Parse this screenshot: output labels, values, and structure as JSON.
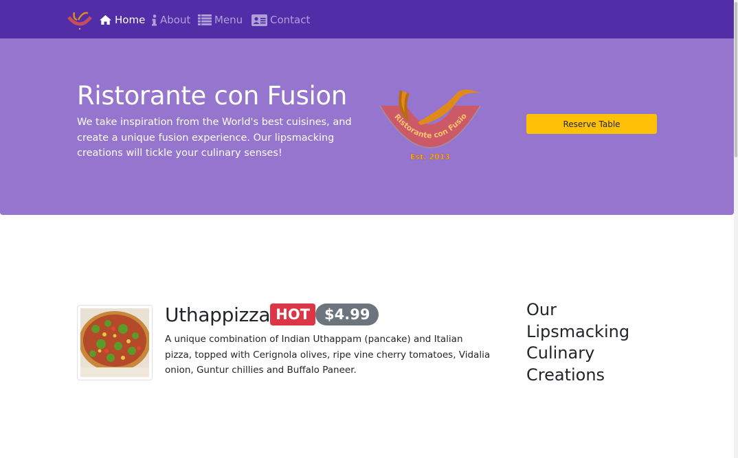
{
  "navbar": {
    "brand_icon": "restaurant-logo",
    "background": "#512DA8",
    "items": [
      {
        "label": "Home",
        "icon": "home-icon",
        "active": true
      },
      {
        "label": "About",
        "icon": "info-icon",
        "active": false
      },
      {
        "label": "Menu",
        "icon": "list-icon",
        "active": false
      },
      {
        "label": "Contact",
        "icon": "address-card-icon",
        "active": false
      }
    ]
  },
  "hero": {
    "title": "Ristorante con Fusion",
    "text": "We take inspiration from the World's best cuisines, and create a unique fusion experience. Our lipsmacking creations will tickle your culinary senses!",
    "logo_text": "Ristorante con Fusion",
    "logo_est": "Est. 2013",
    "reserve_label": "Reserve Table",
    "background": "#9575CD",
    "button_color": "#FFC107"
  },
  "dish": {
    "image": "pizza",
    "name": "Uthappizza",
    "label": "HOT",
    "price": "$4.99",
    "description": "A unique combination of Indian Uthappam (pancake) and Italian pizza, topped with Cerignola olives, ripe vine cherry tomatoes, Vidalia onion, Guntur chillies and Buffalo Paneer."
  },
  "side": {
    "heading": "Our Lipsmacking Culinary Creations"
  }
}
